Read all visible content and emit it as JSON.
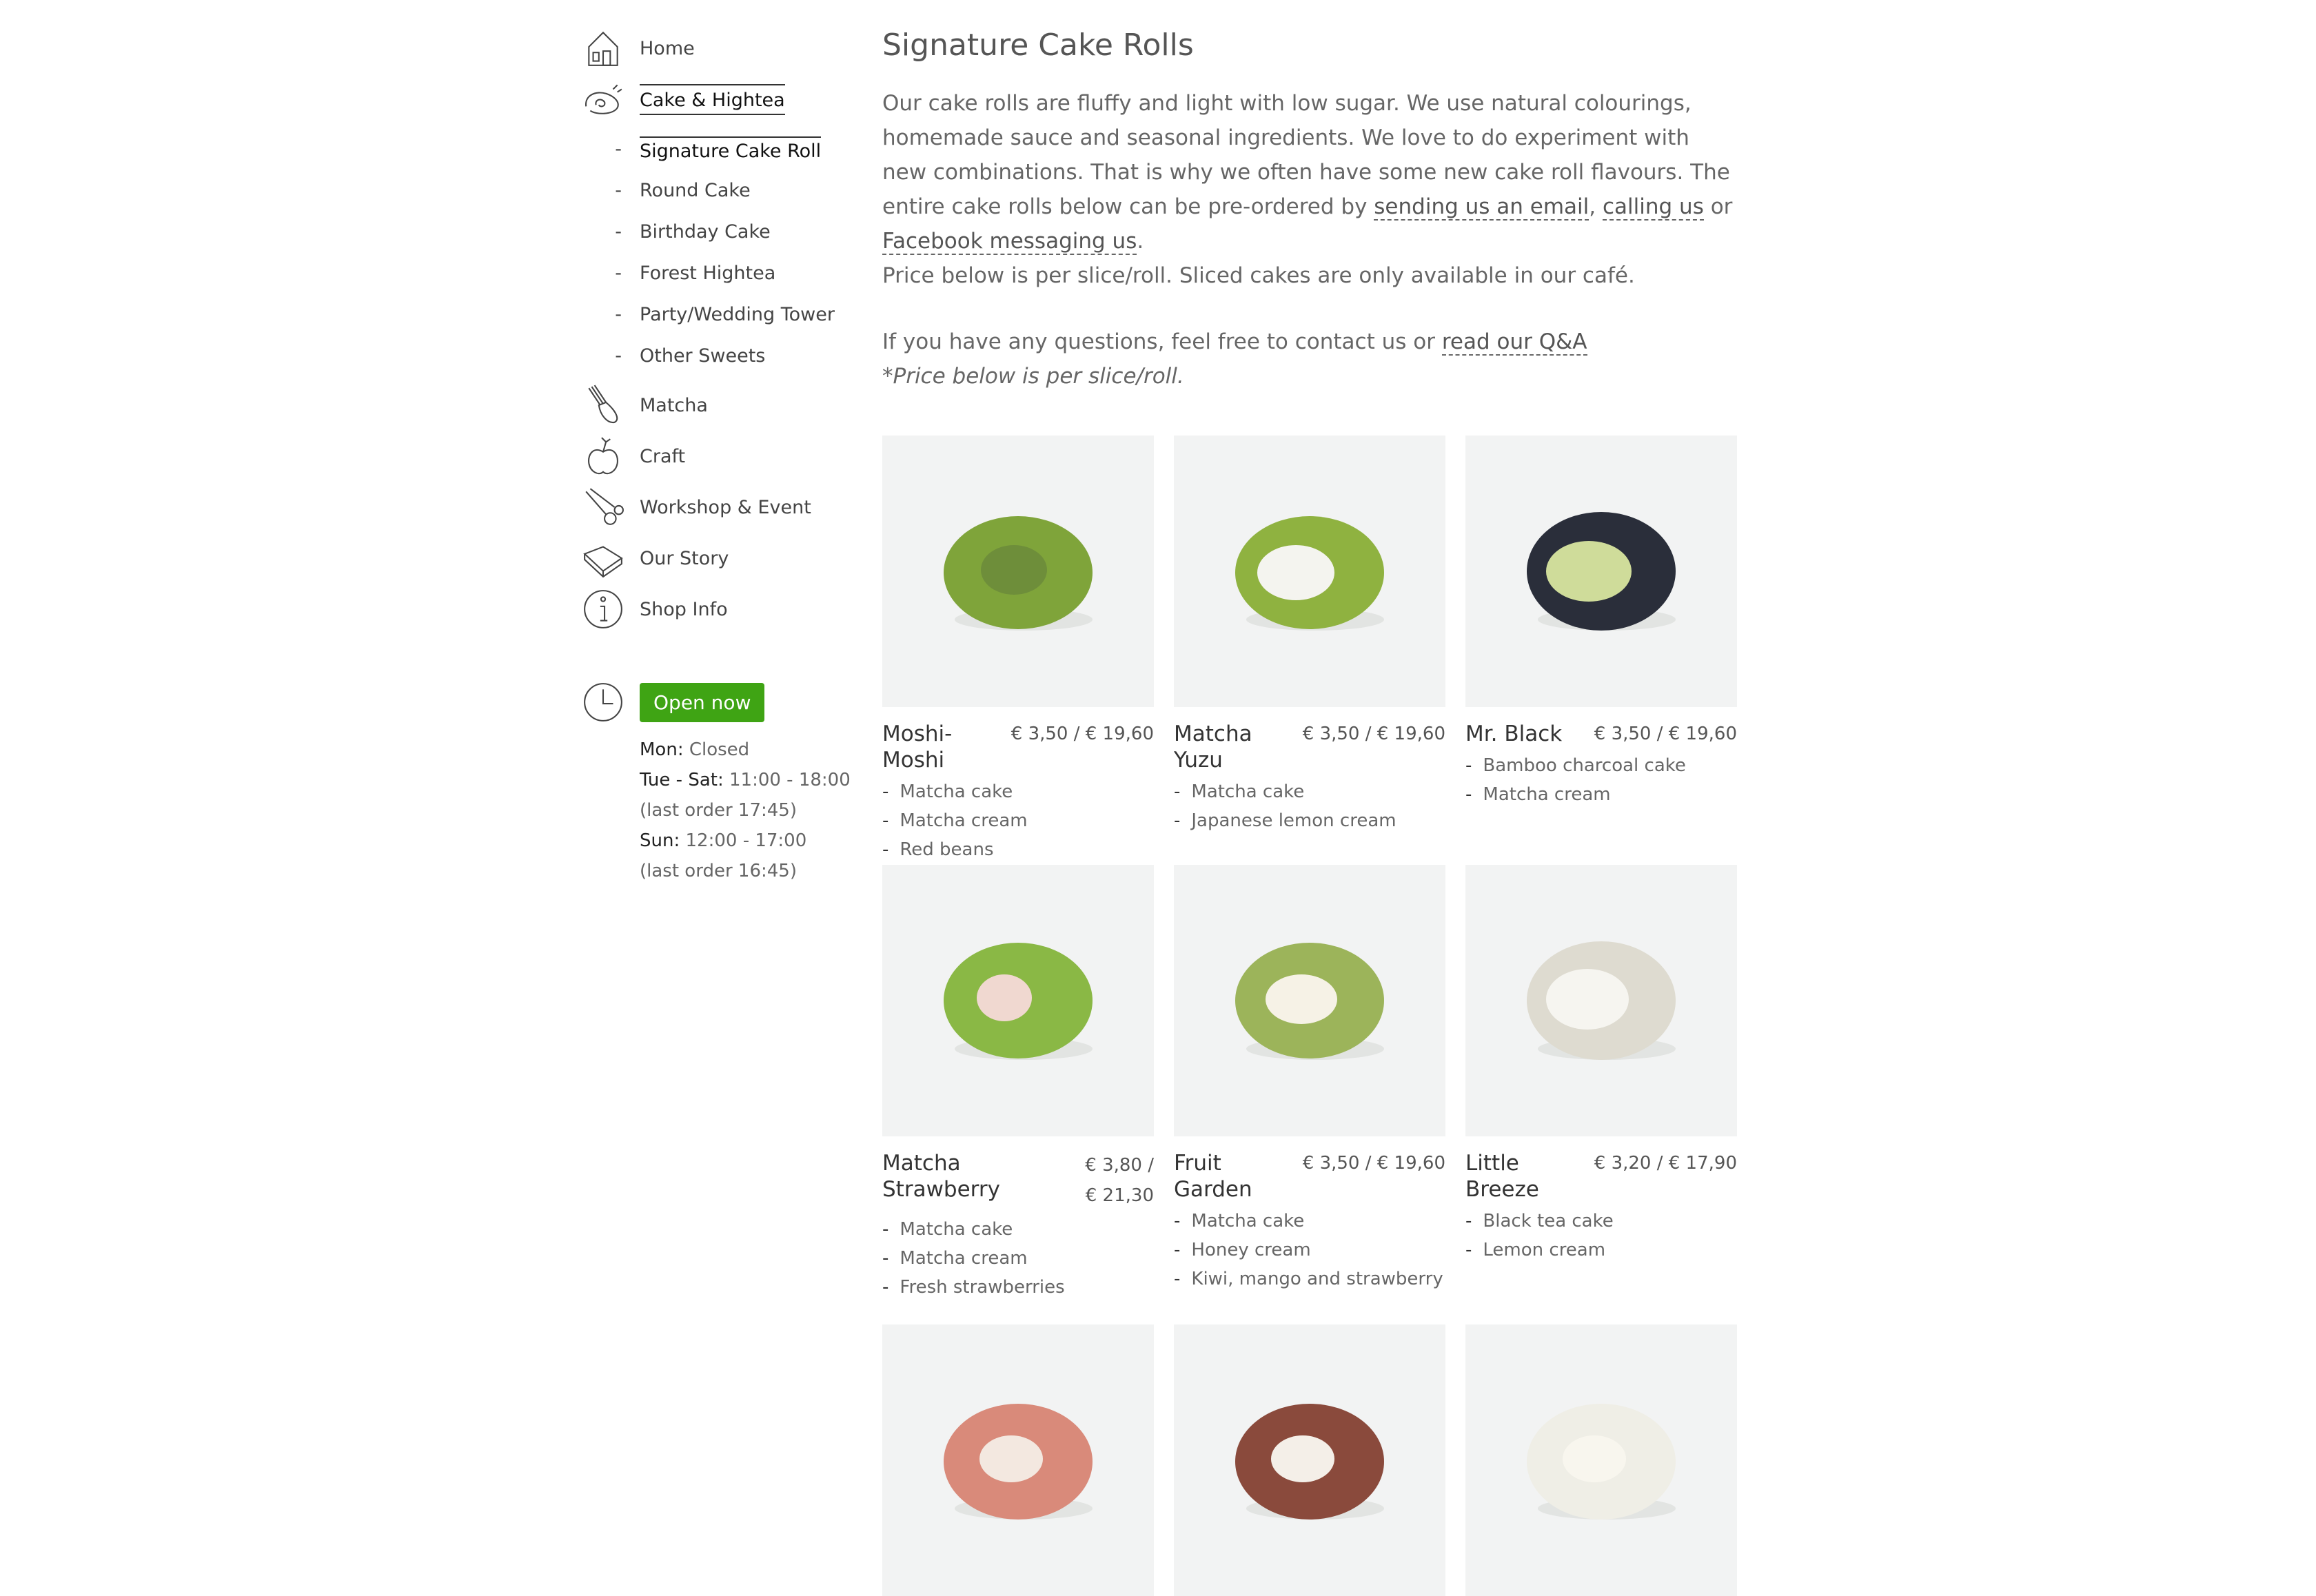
{
  "nav": {
    "items": [
      {
        "label": "Home",
        "icon": "house-icon"
      },
      {
        "label": "Cake & Hightea",
        "icon": "cake-roll-icon",
        "active": true
      },
      {
        "label": "Matcha",
        "icon": "matcha-whisk-icon"
      },
      {
        "label": "Craft",
        "icon": "apple-craft-icon"
      },
      {
        "label": "Workshop & Event",
        "icon": "scissors-icon"
      },
      {
        "label": "Our Story",
        "icon": "book-icon"
      },
      {
        "label": "Shop Info",
        "icon": "info-icon"
      }
    ],
    "subitems": [
      {
        "label": "Signature Cake Roll",
        "active": true
      },
      {
        "label": "Round Cake"
      },
      {
        "label": "Birthday Cake"
      },
      {
        "label": "Forest Hightea"
      },
      {
        "label": "Party/Wedding Tower"
      },
      {
        "label": "Other Sweets"
      }
    ]
  },
  "hours": {
    "status": "Open now",
    "status_color": "#3fa414",
    "icon": "clock-icon",
    "mon_label": "Mon:",
    "mon_value": "Closed",
    "tue_label": "Tue - Sat:",
    "tue_value": "11:00 - 18:00",
    "tue_note": "(last order 17:45)",
    "sun_label": "Sun:",
    "sun_value": "12:00 - 17:00",
    "sun_note": "(last order 16:45)"
  },
  "main": {
    "title": "Signature Cake Rolls",
    "intro_text": "Our cake rolls are fluffy and light with low sugar. We use natural colourings, homemade sauce and seasonal ingredients. We love to do experiment with new combinations. That is why we often have some new cake roll flavours. The entire cake rolls below can be pre-ordered by",
    "link_email": "sending us an email",
    "sep1": ",",
    "link_call": "calling us",
    "or_text": "or",
    "link_facebook": "Facebook messaging us",
    "period": ".",
    "price_note": "Price below is per slice/roll. Sliced cakes are only available in our café.",
    "questions_text": "If you have any questions, feel free to contact us or",
    "link_qa": "read our Q&A",
    "italic_note": "*Price below is per slice/roll."
  },
  "products": [
    {
      "name": "Moshi-Moshi",
      "price": "€ 3,50 / € 19,60",
      "ingredients": [
        "Matcha cake",
        "Matcha cream",
        "Red beans"
      ],
      "sponge": "#7fa43a",
      "filling": "#6e8e3a"
    },
    {
      "name": "Matcha Yuzu",
      "price": "€ 3,50 / € 19,60",
      "ingredients": [
        "Matcha cake",
        "Japanese lemon cream"
      ],
      "sponge": "#8fb240",
      "filling": "#f4f4ef"
    },
    {
      "name": "Mr. Black",
      "price": "€ 3,50 / € 19,60",
      "ingredients": [
        "Bamboo charcoal cake",
        "Matcha cream"
      ],
      "sponge": "#2a2e3a",
      "filling": "#cfdc9a"
    },
    {
      "name": "Matcha Strawberry",
      "price": "€ 3,80 / € 21,30",
      "ingredients": [
        "Matcha cake",
        "Matcha cream",
        "Fresh strawberries"
      ],
      "sponge": "#8ab845",
      "filling": "#f0d8d0"
    },
    {
      "name": "Fruit Garden",
      "price": "€ 3,50 / € 19,60",
      "ingredients": [
        "Matcha cake",
        "Honey cream",
        "Kiwi, mango and strawberry"
      ],
      "sponge": "#9cb45a",
      "filling": "#f6f2e6"
    },
    {
      "name": "Little Breeze",
      "price": "€ 3,20 / € 17,90",
      "ingredients": [
        "Black tea cake",
        "Lemon cream"
      ],
      "sponge": "#dedbd0",
      "filling": "#f6f5f0"
    },
    {
      "sponge": "#d98a7a",
      "filling": "#f3e8e0"
    },
    {
      "sponge": "#8a4a3c",
      "filling": "#f4efe8"
    },
    {
      "sponge": "#efeee6",
      "filling": "#f8f6ee"
    }
  ]
}
